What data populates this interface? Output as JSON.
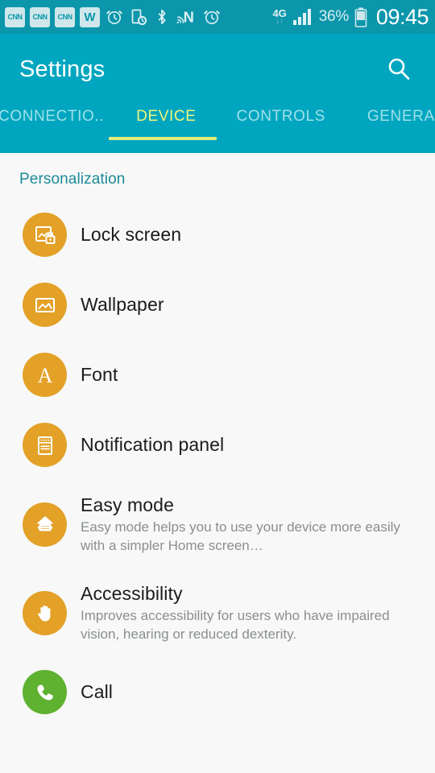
{
  "statusbar": {
    "notifications": [
      {
        "name": "cnn-notification-icon",
        "label": "CNN"
      },
      {
        "name": "cnn-notification-icon",
        "label": "CNN"
      },
      {
        "name": "cnn-notification-icon",
        "label": "CNN"
      },
      {
        "name": "w-app-notification-icon",
        "label": "W"
      }
    ],
    "icons": [
      "alarm-clock-icon",
      "device-schedule-icon",
      "bluetooth-icon",
      "nfc-icon",
      "alarm-clock-icon"
    ],
    "network_type": "4G",
    "data_arrows": "↓↑",
    "signal_icon": "signal-bars-icon",
    "battery_percent": "36%",
    "battery_icon": "battery-icon",
    "time": "09:45"
  },
  "appbar": {
    "title": "Settings",
    "search_icon": "search-icon",
    "tabs": [
      {
        "label": "CONNECTIO..",
        "active": false
      },
      {
        "label": "DEVICE",
        "active": true
      },
      {
        "label": "CONTROLS",
        "active": false
      },
      {
        "label": "GENERAL",
        "active": false
      }
    ]
  },
  "main": {
    "section_title": "Personalization",
    "items": [
      {
        "title": "Lock screen",
        "subtitle": "",
        "icon": "lock-screen-icon",
        "icon_color": "#e3a128"
      },
      {
        "title": "Wallpaper",
        "subtitle": "",
        "icon": "wallpaper-icon",
        "icon_color": "#e3a128"
      },
      {
        "title": "Font",
        "subtitle": "",
        "icon": "font-icon",
        "icon_color": "#e3a128"
      },
      {
        "title": "Notification panel",
        "subtitle": "",
        "icon": "notification-panel-icon",
        "icon_color": "#e3a128"
      },
      {
        "title": "Easy mode",
        "subtitle": "Easy mode helps you to use your device more easily with a simpler Home screen…",
        "icon": "easy-mode-icon",
        "icon_color": "#e3a128"
      },
      {
        "title": "Accessibility",
        "subtitle": "Improves accessibility for users who have impaired vision, hearing or reduced dexterity.",
        "icon": "accessibility-hand-icon",
        "icon_color": "#e3a128"
      },
      {
        "title": "Call",
        "subtitle": "",
        "icon": "call-phone-icon",
        "icon_color": "#5fb130"
      }
    ]
  },
  "colors": {
    "appbar": "#00a6bf",
    "statusbar": "#0b96ab",
    "accent_tab": "#e3ee7a",
    "section_title": "#1c8b99",
    "icon_orange": "#e3a128",
    "icon_green": "#5fb130",
    "background": "#f7f8f7"
  }
}
